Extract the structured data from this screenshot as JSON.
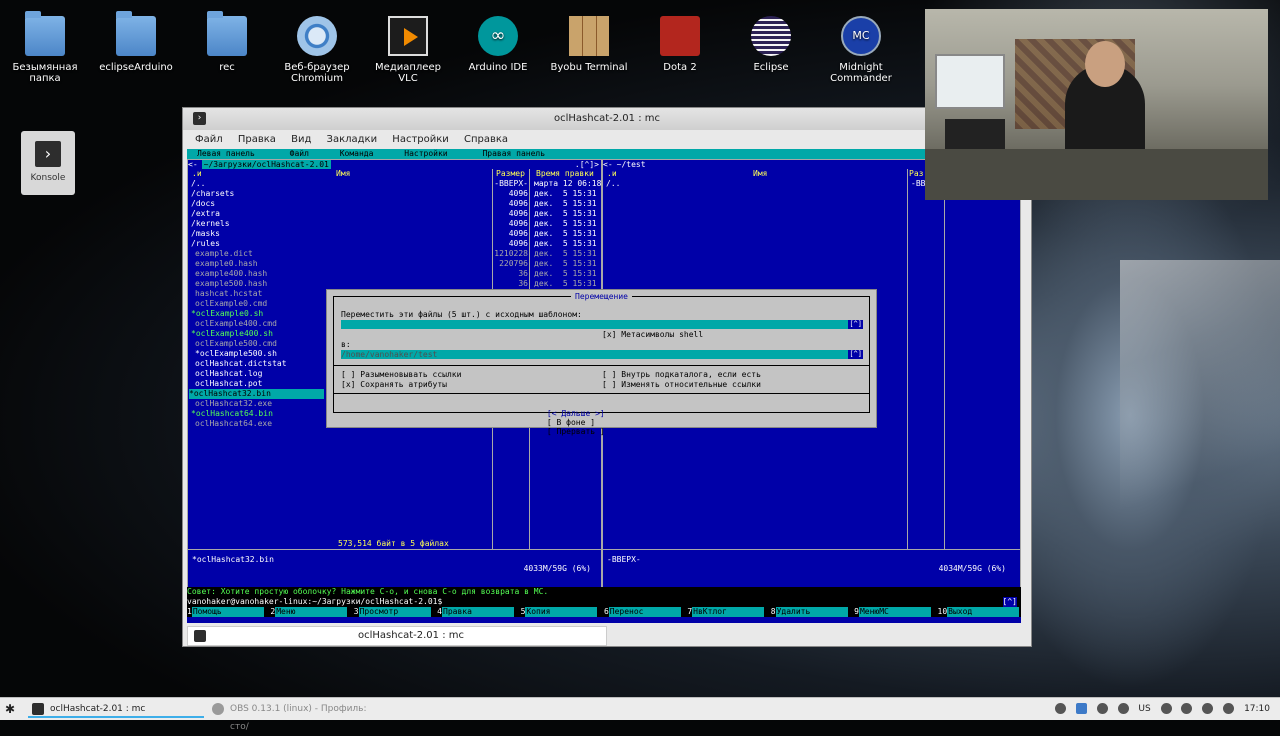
{
  "desktop": {
    "icons": [
      {
        "label": "Безымянная папка",
        "icon": "folder-icon"
      },
      {
        "label": "eclipseArduino",
        "icon": "folder-icon"
      },
      {
        "label": "rec",
        "icon": "folder-icon"
      },
      {
        "label": "Веб-браузер Chromium",
        "icon": "chromium-icon"
      },
      {
        "label": "Медиаплеер VLC",
        "icon": "vlc-icon"
      },
      {
        "label": "Arduino IDE",
        "icon": "arduino-icon"
      },
      {
        "label": "Byobu Terminal",
        "icon": "byobu-icon"
      },
      {
        "label": "Dota 2",
        "icon": "dota-icon"
      },
      {
        "label": "Eclipse",
        "icon": "eclipse-icon"
      },
      {
        "label": "Midnight Commander",
        "icon": "mc-icon"
      }
    ],
    "konsole_label": "Konsole"
  },
  "window": {
    "title": "oclHashcat-2.01 : mc",
    "menu": [
      "Файл",
      "Правка",
      "Вид",
      "Закладки",
      "Настройки",
      "Справка"
    ],
    "bottom_tab": "oclHashcat-2.01 : mc"
  },
  "mc": {
    "topmenu": [
      "Левая панель",
      "Файл",
      "Команда",
      "Настройки",
      "Правая панель"
    ],
    "left": {
      "path": "~/Загрузки/oclHashcat-2.01",
      "sort_marker": ".[^]>",
      "cols": {
        "name": "Имя",
        "size": "Размер",
        "time": "Время правки",
        "sort": ".и"
      },
      "rows": [
        {
          "name": "/..",
          "size": "-ВВЕРХ-",
          "time": "марта 12 06:18",
          "kind": "dir"
        },
        {
          "name": "/charsets",
          "size": "4096",
          "time": "дек.  5 15:31",
          "kind": "dir"
        },
        {
          "name": "/docs",
          "size": "4096",
          "time": "дек.  5 15:31",
          "kind": "dir"
        },
        {
          "name": "/extra",
          "size": "4096",
          "time": "дек.  5 15:31",
          "kind": "dir"
        },
        {
          "name": "/kernels",
          "size": "4096",
          "time": "дек.  5 15:31",
          "kind": "dir"
        },
        {
          "name": "/masks",
          "size": "4096",
          "time": "дек.  5 15:31",
          "kind": "dir"
        },
        {
          "name": "/rules",
          "size": "4096",
          "time": "дек.  5 15:31",
          "kind": "dir"
        },
        {
          "name": "example.dict",
          "size": "1210228",
          "time": "дек.  5 15:31",
          "kind": "file"
        },
        {
          "name": "example0.hash",
          "size": "220796",
          "time": "дек.  5 15:31",
          "kind": "file"
        },
        {
          "name": "example400.hash",
          "size": "36",
          "time": "дек.  5 15:31",
          "kind": "file"
        },
        {
          "name": "example500.hash",
          "size": "36",
          "time": "дек.  5 15:31",
          "kind": "file"
        },
        {
          "name": "hashcat.hcstat",
          "size": "",
          "time": "",
          "kind": "file"
        },
        {
          "name": "oclExample0.cmd",
          "size": "",
          "time": "",
          "kind": "file"
        },
        {
          "name": "*oclExample0.sh",
          "size": "",
          "time": "",
          "kind": "exec"
        },
        {
          "name": "oclExample400.cmd",
          "size": "",
          "time": "",
          "kind": "file"
        },
        {
          "name": "*oclExample400.sh",
          "size": "",
          "time": "",
          "kind": "exec"
        },
        {
          "name": "oclExample500.cmd",
          "size": "",
          "time": "",
          "kind": "file"
        },
        {
          "name": "*oclExample500.sh",
          "size": "",
          "time": "",
          "kind": "mark"
        },
        {
          "name": "oclHashcat.dictstat",
          "size": "",
          "time": "",
          "kind": "mark"
        },
        {
          "name": "oclHashcat.log",
          "size": "",
          "time": "",
          "kind": "mark"
        },
        {
          "name": "oclHashcat.pot",
          "size": "",
          "time": "",
          "kind": "mark"
        },
        {
          "name": "*oclHashcat32.bin",
          "size": "",
          "time": "",
          "kind": "sel"
        },
        {
          "name": "oclHashcat32.exe",
          "size": "",
          "time": "",
          "kind": "file"
        },
        {
          "name": "*oclHashcat64.bin",
          "size": "",
          "time": "",
          "kind": "exec"
        },
        {
          "name": "oclHashcat64.exe",
          "size": "",
          "time": "",
          "kind": "file"
        }
      ],
      "summary": "573,514 байт в 5 файлах",
      "current": "*oclHashcat32.bin",
      "disk": "4033M/59G (6%)"
    },
    "right": {
      "path": "~/test",
      "sort_marker": ".[^]>",
      "cols": {
        "name": "Имя",
        "size": "Раз",
        "sort": ".и"
      },
      "rows": [
        {
          "name": "/..",
          "size": "-ВВ"
        }
      ],
      "current": "-ВВЕРХ-",
      "disk": "4034M/59G (6%)"
    },
    "hint": "Совет: Хотите простую оболочку? Нажмите C-o, и снова C-o для возврата в MC.",
    "prompt": "vanohaker@vanohaker-linux:~/Загрузки/oclHashcat-2.01$",
    "prompt_marker": "[^]",
    "fkeys": [
      {
        "n": "1",
        "label": "Помощь"
      },
      {
        "n": "2",
        "label": "Меню"
      },
      {
        "n": "3",
        "label": "Просмотр"
      },
      {
        "n": "4",
        "label": "Правка"
      },
      {
        "n": "5",
        "label": "Копия"
      },
      {
        "n": "6",
        "label": "Перенос"
      },
      {
        "n": "7",
        "label": "НвКтлог"
      },
      {
        "n": "8",
        "label": "Удалить"
      },
      {
        "n": "9",
        "label": "МенюMC"
      },
      {
        "n": "10",
        "label": "Выход"
      }
    ]
  },
  "dialog": {
    "title": "Перемещение",
    "source_label": "Переместить эти файлы (5 шт.) с исходным шаблоном:",
    "source_value": "",
    "shell_meta": "[x] Метасимволы shell",
    "dest_label": "в:",
    "dest_value": "/home/vanohaker/test",
    "hist": "[^]",
    "opt_deref": "[ ] Разыменовывать ссылки",
    "opt_attr": "[x] Сохранять атрибуты",
    "opt_inside": "[ ] Внутрь подкаталога, если есть",
    "opt_rel": "[ ] Изменять относительные ссылки",
    "btn_next": "[< Дальше >]",
    "btn_bg": "[ В фоне ]",
    "btn_abort": "[ Прервать ]"
  },
  "taskbar": {
    "tasks": [
      {
        "label": "oclHashcat-2.01 : mc",
        "active": true
      },
      {
        "label": "OBS 0.13.1 (linux) - Профиль: сто/",
        "active": false
      }
    ],
    "lang": "US",
    "time": "17:10"
  }
}
